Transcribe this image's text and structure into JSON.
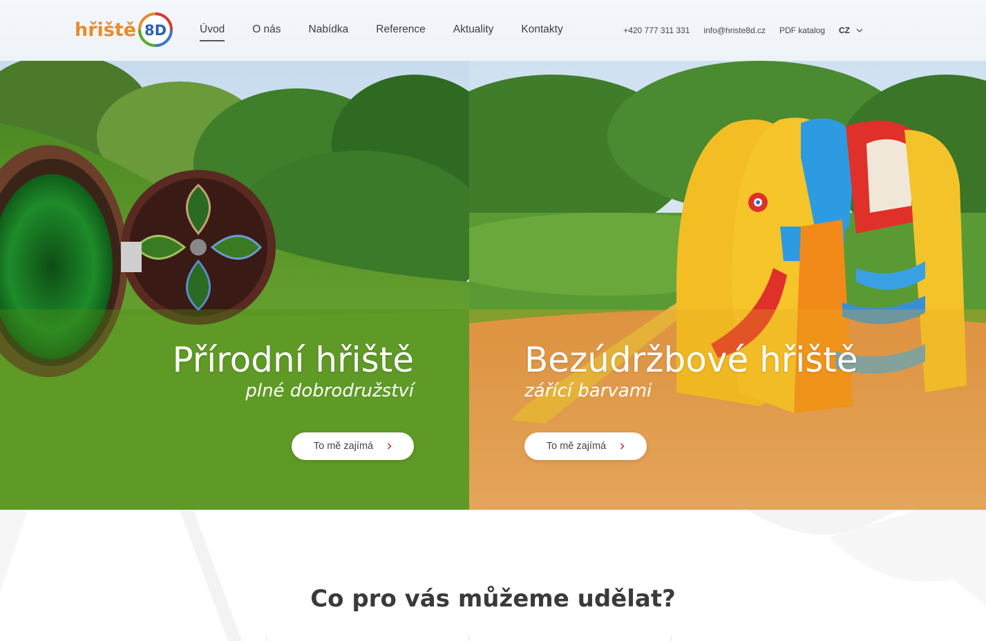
{
  "header": {
    "logo": {
      "text": "hřiště",
      "badge": "8D"
    },
    "nav": [
      {
        "label": "Úvod",
        "active": true
      },
      {
        "label": "O nás",
        "active": false
      },
      {
        "label": "Nabídka",
        "active": false
      },
      {
        "label": "Reference",
        "active": false
      },
      {
        "label": "Aktuality",
        "active": false
      },
      {
        "label": "Kontakty",
        "active": false
      }
    ],
    "phone": "+420 777 311 331",
    "email": "info@hriste8d.cz",
    "catalog": "PDF katalog",
    "language": "CZ",
    "icons": {
      "language_dropdown": "chevron-down-icon"
    }
  },
  "hero": {
    "left": {
      "title": "Přírodní hřiště",
      "subtitle": "plné dobrodružství",
      "button": "To mě zajímá",
      "icon": "chevron-right-icon",
      "overlay_color": "#4c8c14"
    },
    "right": {
      "title": "Bezúdržbové hřiště",
      "subtitle": "zářící barvami",
      "button": "To mě zajímá",
      "icon": "chevron-right-icon",
      "overlay_color": "#e8aa1e"
    }
  },
  "section": {
    "title": "Co pro vás můžeme udělat?"
  },
  "colors": {
    "accent_orange": "#e98a2a",
    "chevron_red": "#d0203a",
    "text_dark": "#3a3a3a"
  }
}
